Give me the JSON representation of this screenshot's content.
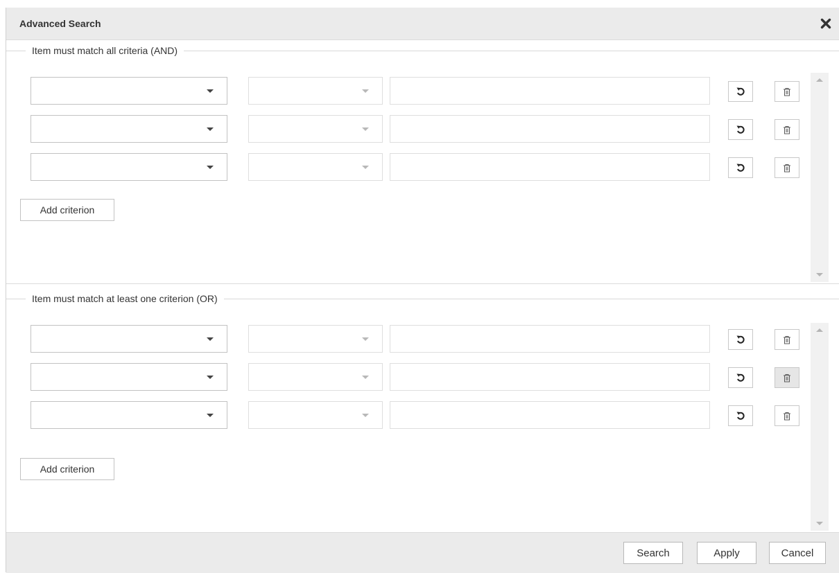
{
  "dialog": {
    "title": "Advanced Search",
    "close_icon": "close-icon"
  },
  "and_section": {
    "legend": "Item must match all criteria (AND)",
    "add_label": "Add criterion",
    "rows": [
      {
        "field": "",
        "operator": "",
        "value": ""
      },
      {
        "field": "",
        "operator": "",
        "value": ""
      },
      {
        "field": "",
        "operator": "",
        "value": ""
      }
    ]
  },
  "or_section": {
    "legend": "Item must match at least one criterion (OR)",
    "add_label": "Add criterion",
    "rows": [
      {
        "field": "",
        "operator": "",
        "value": ""
      },
      {
        "field": "",
        "operator": "",
        "value": ""
      },
      {
        "field": "",
        "operator": "",
        "value": ""
      }
    ]
  },
  "footer": {
    "search_label": "Search",
    "apply_label": "Apply",
    "cancel_label": "Cancel"
  },
  "icons": {
    "reset": "undo-icon",
    "delete": "trash-icon",
    "dropdown": "caret-down-icon"
  },
  "colors": {
    "titlebar": "#ebebeb",
    "border": "#c2c2c2"
  }
}
